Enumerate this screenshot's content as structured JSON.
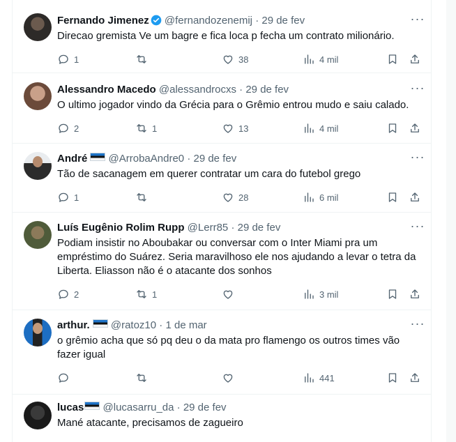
{
  "tweets": [
    {
      "name": "Fernando Jimenez",
      "verified": true,
      "flag": false,
      "handle": "@fernandozenemij",
      "date": "29 de fev",
      "text": "Direcao gremista Ve um bagre e fica loca p fecha um contrato milionário.",
      "replies": "1",
      "retweets": "",
      "likes": "38",
      "views": "4 mil"
    },
    {
      "name": "Alessandro Macedo",
      "verified": false,
      "flag": false,
      "handle": "@alessandrocxs",
      "date": "29 de fev",
      "text": "O ultimo jogador vindo da Grécia para o Grêmio entrou mudo e saiu calado.",
      "replies": "2",
      "retweets": "1",
      "likes": "13",
      "views": "4 mil"
    },
    {
      "name": "André",
      "verified": false,
      "flag": true,
      "handle": "@ArrobaAndre0",
      "date": "29 de fev",
      "text": "Tão de sacanagem em querer contratar um cara do futebol grego",
      "replies": "1",
      "retweets": "",
      "likes": "28",
      "views": "6 mil"
    },
    {
      "name": "Luís Eugênio Rolim Rupp",
      "verified": false,
      "flag": false,
      "handle": "@Lerr85",
      "date": "29 de fev",
      "text": "Podiam insistir no Aboubakar ou conversar com o Inter Miami pra um empréstimo do Suárez. Seria maravilhoso ele nos ajudando a levar o tetra da Liberta. Eliasson não é o atacante dos sonhos",
      "replies": "2",
      "retweets": "1",
      "likes": "",
      "views": "3 mil"
    },
    {
      "name": "arthur.",
      "verified": false,
      "flag": true,
      "handle": "@ratoz10",
      "date": "1 de mar",
      "text": "o grêmio acha que só pq deu o da mata pro flamengo os outros times vão fazer igual",
      "replies": "",
      "retweets": "",
      "likes": "",
      "views": "441"
    },
    {
      "name": "lucas",
      "verified": false,
      "flag": true,
      "handle": "@lucasarru_da",
      "date": "29 de fev",
      "text": "Mané atacante, precisamos de zagueiro",
      "replies": "",
      "retweets": "",
      "likes": "",
      "views": ""
    }
  ],
  "ui": {
    "dot": "·",
    "more": "···"
  }
}
